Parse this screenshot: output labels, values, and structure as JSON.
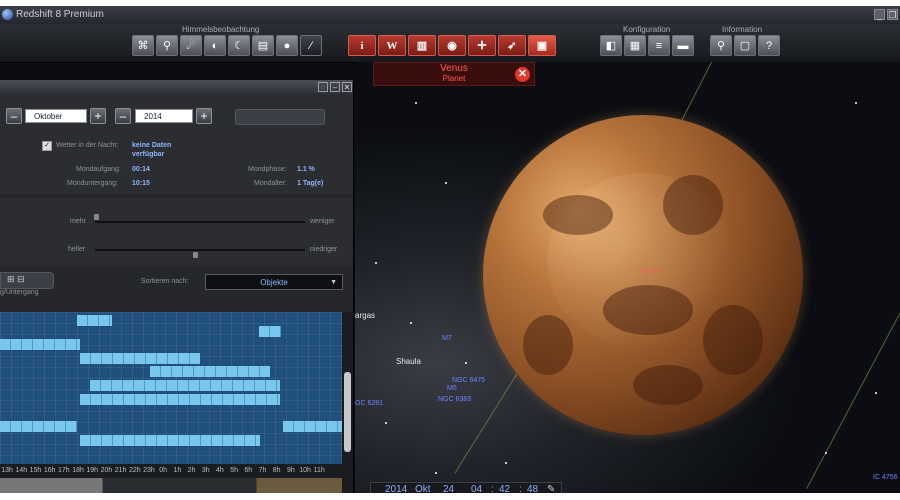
{
  "window": {
    "title": "Redshift 8 Premium",
    "minimize_glyph": "_",
    "restore_glyph": "❐"
  },
  "toolbar": {
    "groups": {
      "observation": "Himmelsbeobachtung",
      "configuration": "Konfiguration",
      "information": "Information"
    },
    "info_buttons": [
      "i",
      "W"
    ]
  },
  "object_info": {
    "name": "Venus",
    "category": "Planet",
    "close_glyph": "✕"
  },
  "panel": {
    "month": "Oktober",
    "year": "2014",
    "weather_label": "Wetter in der Nacht:",
    "weather_value_line1": "keine Daten",
    "weather_value_line2": "verfügbar",
    "moonrise_label": "Mondaufgang:",
    "moonrise_value": "00:14",
    "moonset_label": "Monduntergang:",
    "moonset_value": "10:15",
    "moonphase_label": "Mondphase:",
    "moonphase_value": "1.1 %",
    "moonage_label": "Mondalter:",
    "moonage_value": "1 Tag(e)",
    "slider1_left": "mehr",
    "slider1_right": "weniger",
    "slider2_left": "heller",
    "slider2_right": "niedriger",
    "rise_set_label": "g/Untergang",
    "sort_label": "Sortieren nach:",
    "sort_value": "Objekte",
    "hours": [
      "13h",
      "14h",
      "15h",
      "16h",
      "17h",
      "18h",
      "19h",
      "20h",
      "21h",
      "22h",
      "23h",
      "0h",
      "1h",
      "2h",
      "3h",
      "4h",
      "5h",
      "6h",
      "7h",
      "8h",
      "9h",
      "10h",
      "11h"
    ]
  },
  "sky_labels": {
    "venus": "Venus",
    "vargas": "argas",
    "shaula": "Shaula",
    "m7": "M7",
    "m6": "M6",
    "ngc6475": "NGC 6475",
    "ngc6383": "NGC 6383",
    "ngc6281": "GC 6281",
    "ic": "IC 4756"
  },
  "timebar": {
    "year": "2014",
    "month": "Okt",
    "day": "24",
    "hour": "04",
    "minute": "42",
    "second": "48"
  }
}
